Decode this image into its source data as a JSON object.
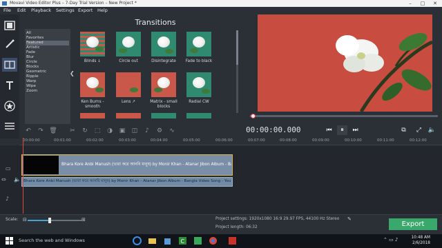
{
  "titlebar": {
    "title": "Movavi Video Editor Plus – 7-Day Trial Version – New Project *"
  },
  "menu": [
    "File",
    "Edit",
    "Playback",
    "Settings",
    "Export",
    "Help"
  ],
  "tools": [
    "film-icon",
    "magic-wand-icon",
    "transitions-icon",
    "text-icon",
    "star-icon",
    "list-icon"
  ],
  "categories": [
    "All",
    "Favorites",
    "Featured",
    "Artistic",
    "Fade",
    "Blur",
    "Circle",
    "Blocks",
    "Geometric",
    "Ripple",
    "Warp",
    "Wipe",
    "Zoom"
  ],
  "selected_category": "Featured",
  "transitions": {
    "title": "Transitions",
    "tiles": [
      {
        "label": "Blinds ↓"
      },
      {
        "label": "Circle out"
      },
      {
        "label": "Disintegrate"
      },
      {
        "label": "Fade to black"
      },
      {
        "label": "Ken Burns - smooth"
      },
      {
        "label": "Lens ↗"
      },
      {
        "label": "Matrix - small blocks"
      },
      {
        "label": "Radial CW"
      }
    ]
  },
  "player": {
    "timecode": "00:00:00.000"
  },
  "ruler": [
    "00:00:00",
    "00:01:00",
    "00:02:00",
    "00:03:00",
    "00:04:00",
    "00:05:00",
    "00:06:00",
    "00:07:00",
    "00:08:00",
    "00:09:00",
    "00:10:00",
    "00:11:00",
    "00:12:00"
  ],
  "timeline": {
    "video_clip": "Bhara Kore Anbi Manush (ভারা করে আনবি মানুষ) by Monir Khan - Atanar Jibon Album - Bangla",
    "audio_clip": "Bhara Kore Anbi Manush (ভারা করে আনবি মানুষ) by Monir Khan - Atanar Jibon Album - Bangla Video Song - YouT"
  },
  "bottom": {
    "scale_label": "Scale:",
    "project_settings": "Project settings:  1920x1080 16:9 29.97 FPS, 44100 Hz Stereo",
    "project_length": "Project length:   06:32",
    "export_label": "Export"
  },
  "taskbar": {
    "search_text": "Search the web and Windows",
    "time": "10:48 AM",
    "date": "2/6/2018"
  },
  "colors": {
    "accent": "#3aa86b",
    "playhead": "#e34a3a",
    "clip": "#7a8ea8"
  }
}
